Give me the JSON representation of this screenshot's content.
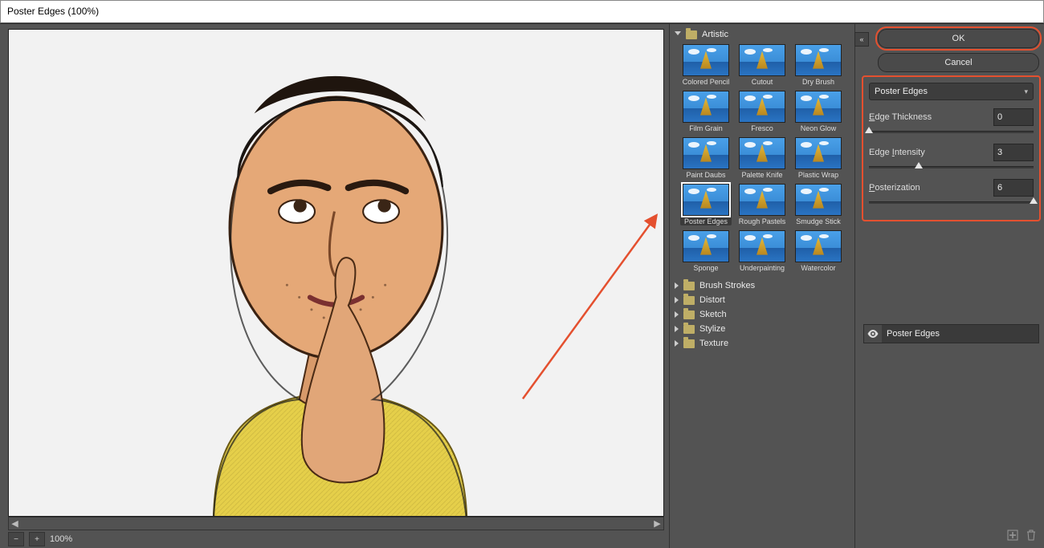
{
  "window": {
    "title": "Poster Edges (100%)"
  },
  "zoom": {
    "value": "100%"
  },
  "gallery": {
    "open_category": "Artistic",
    "thumbs": [
      {
        "label": "Colored Pencil"
      },
      {
        "label": "Cutout"
      },
      {
        "label": "Dry Brush"
      },
      {
        "label": "Film Grain"
      },
      {
        "label": "Fresco"
      },
      {
        "label": "Neon Glow"
      },
      {
        "label": "Paint Daubs"
      },
      {
        "label": "Palette Knife"
      },
      {
        "label": "Plastic Wrap"
      },
      {
        "label": "Poster Edges",
        "selected": true
      },
      {
        "label": "Rough Pastels"
      },
      {
        "label": "Smudge Stick"
      },
      {
        "label": "Sponge"
      },
      {
        "label": "Underpainting"
      },
      {
        "label": "Watercolor"
      }
    ],
    "categories": [
      "Brush Strokes",
      "Distort",
      "Sketch",
      "Stylize",
      "Texture"
    ]
  },
  "buttons": {
    "ok": "OK",
    "cancel": "Cancel"
  },
  "filter": {
    "name": "Poster Edges",
    "params": [
      {
        "label": "Edge Thickness",
        "underline": "E",
        "value": "0",
        "pos": 0
      },
      {
        "label": "Edge Intensity",
        "underline": "I",
        "value": "3",
        "pos": 30
      },
      {
        "label": "Posterization",
        "underline": "P",
        "value": "6",
        "pos": 100
      }
    ]
  },
  "layer": {
    "name": "Poster Edges"
  }
}
